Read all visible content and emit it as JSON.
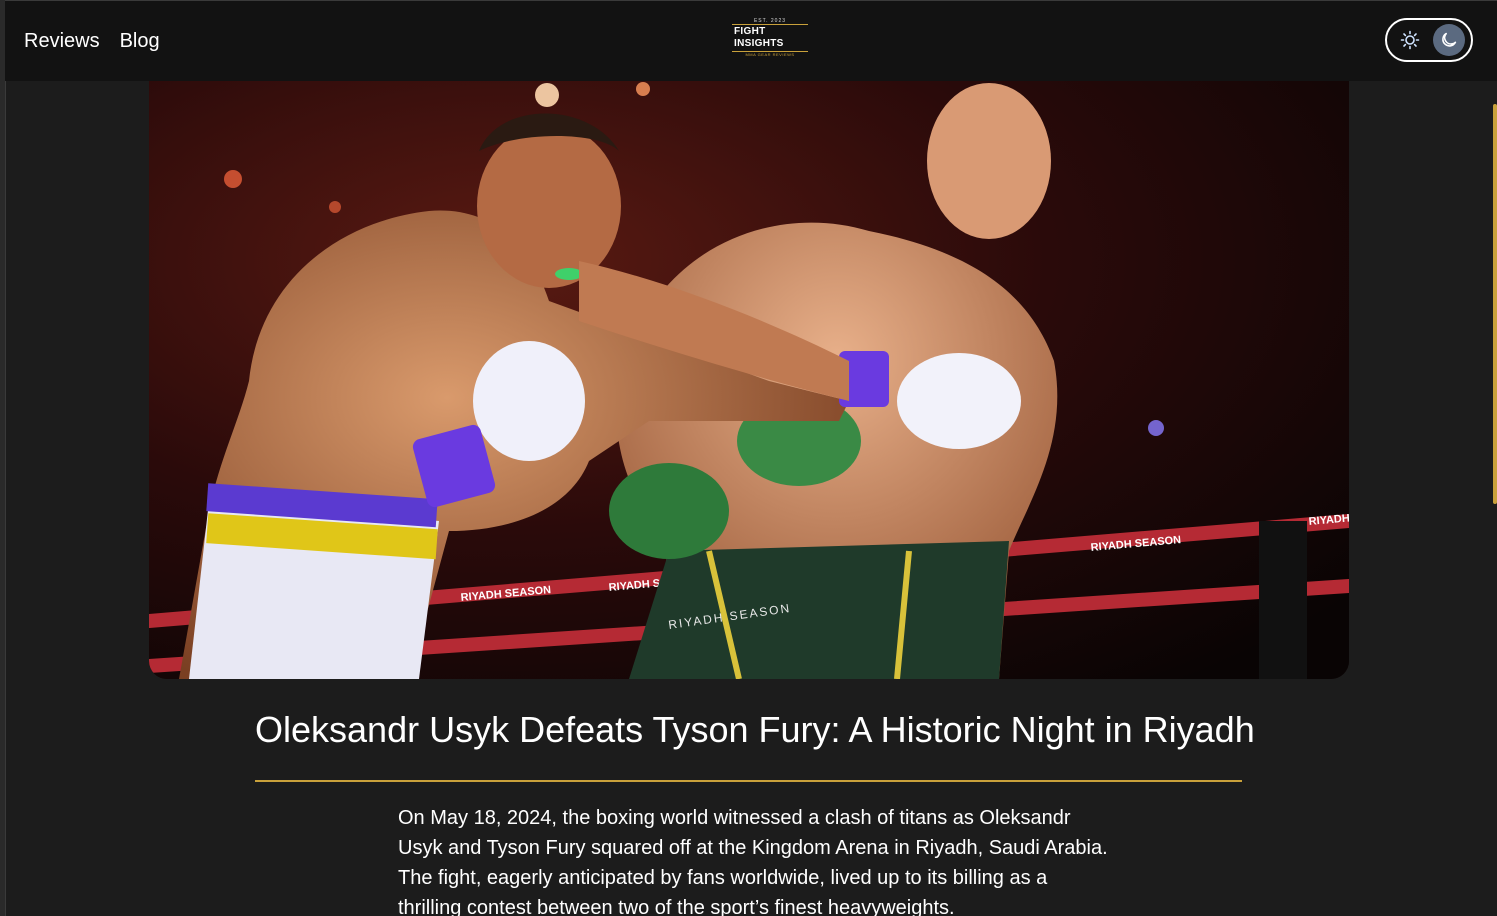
{
  "nav": {
    "links": [
      "Reviews",
      "Blog"
    ]
  },
  "logo": {
    "est": "EST. 2023",
    "name": "FIGHT INSIGHTS",
    "tagline": "MMA GEAR REVIEWS"
  },
  "theme_toggle": {
    "light_icon": "sun-icon",
    "dark_icon": "moon-icon",
    "active": "dark"
  },
  "article": {
    "title": "Oleksandr Usyk Defeats Tyson Fury: A Historic Night in Riyadh",
    "body": "On May 18, 2024, the boxing world witnessed a clash of titans as Oleksandr Usyk and Tyson Fury squared off at the Kingdom Arena in Riyadh, Saudi Arabia. The fight, eagerly anticipated by fans worldwide, lived up to its billing as a thrilling contest between two of the sport’s finest heavyweights."
  },
  "hero_image": {
    "ring_text": [
      "RIYADH SEASON",
      "RIYADH SEASON",
      "RIYADH SEASON",
      "RIYADH SEASON"
    ],
    "trunks_text": "RIYADH SEASON"
  },
  "colors": {
    "accent": "#c9a13b",
    "nav_bg": "#121212",
    "page_bg": "#1c1c1c",
    "toggle_active": "#5b6a80"
  }
}
